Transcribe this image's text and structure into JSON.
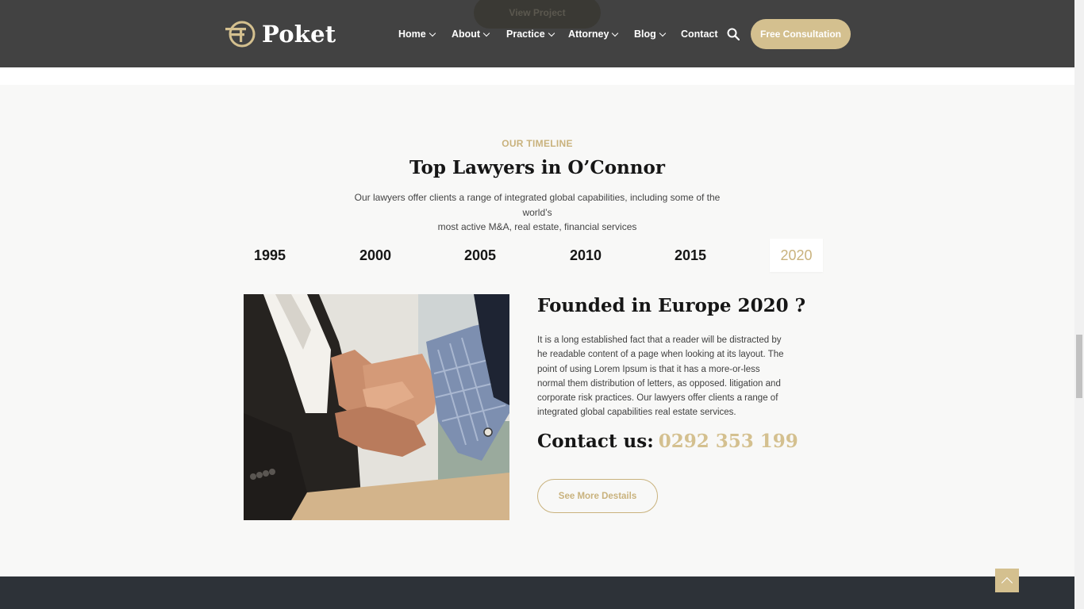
{
  "header": {
    "logo_text": "Poket",
    "ghost_button": "View Project",
    "nav": [
      {
        "label": "Home",
        "has_dropdown": true
      },
      {
        "label": "About",
        "has_dropdown": true
      },
      {
        "label": "Practice",
        "has_dropdown": true
      },
      {
        "label": "Attorney",
        "has_dropdown": true
      },
      {
        "label": "Blog",
        "has_dropdown": true
      },
      {
        "label": "Contact",
        "has_dropdown": false
      }
    ],
    "search_icon": "search-icon",
    "cta_label": "Free Consultation"
  },
  "timeline": {
    "eyebrow": "OUR TIMELINE",
    "title": "Top Lawyers in O’Connor",
    "lead_line1": "Our lawyers offer clients a range of integrated global capabilities, including some of the world’s",
    "lead_line2": "most active M&A, real estate, financial services",
    "years": [
      "1995",
      "2000",
      "2005",
      "2010",
      "2015",
      "2020"
    ],
    "active_year": "2020"
  },
  "content": {
    "heading": "Founded in Europe 2020 ?",
    "paragraph": "It is a long established fact that a reader will be distracted by he readable content of a page when looking at its layout. The point of using Lorem Ipsum is that it has a more-or-less normal them distribution of letters, as opposed. litigation and corporate risk practices. Our lawyers offer clients a range of integrated global capabilities real estate services.",
    "contact_label": "Contact us:",
    "phone": "0292 353 199",
    "details_button": "See More Destails"
  },
  "colors": {
    "accent": "#d4c08f",
    "header_bg": "#3a3a3a",
    "footer_bg": "#2d3238",
    "text_dark": "#161616"
  }
}
